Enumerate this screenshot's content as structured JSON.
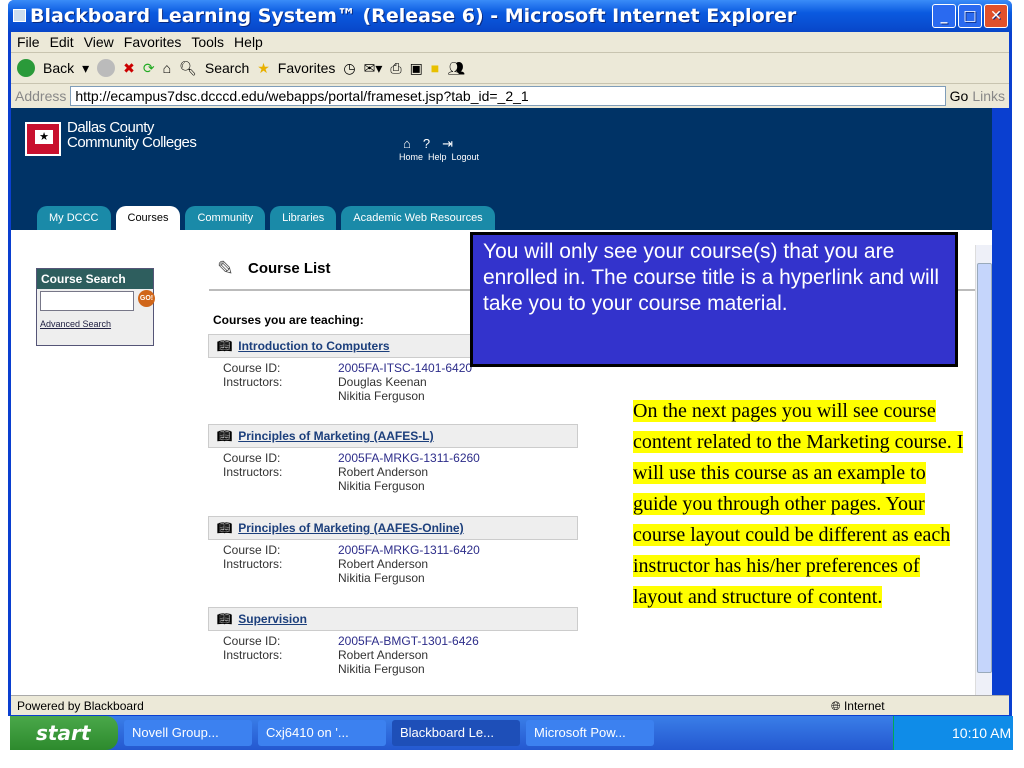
{
  "window": {
    "title": "Blackboard Learning System™ (Release 6) - Microsoft Internet Explorer"
  },
  "menu": [
    "File",
    "Edit",
    "View",
    "Favorites",
    "Tools",
    "Help"
  ],
  "toolbar": {
    "back": "Back",
    "search": "Search",
    "favorites": "Favorites"
  },
  "address": {
    "label": "Address",
    "url": "http://ecampus7dsc.dcccd.edu/webapps/portal/frameset.jsp?tab_id=_2_1",
    "go": "Go",
    "links": "Links"
  },
  "header": {
    "brand_line1": "Dallas County",
    "brand_line2": "Community Colleges",
    "home": "Home",
    "help": "Help",
    "logout": "Logout"
  },
  "tabs": [
    "My DCCC",
    "Courses",
    "Community",
    "Libraries",
    "Academic Web Resources"
  ],
  "sidebar": {
    "title": "Course Search",
    "go": "GO!",
    "advanced": "Advanced Search"
  },
  "main": {
    "title": "Course List",
    "section": "Courses you are teaching:",
    "id_label": "Course ID:",
    "instructors_label": "Instructors:",
    "courses": [
      {
        "name": "Introduction to Computers",
        "id": "2005FA-ITSC-1401-6420",
        "instructors": [
          "Douglas Keenan",
          "Nikitia Ferguson"
        ]
      },
      {
        "name": "Principles of Marketing (AAFES-L)",
        "id": "2005FA-MRKG-1311-6260",
        "instructors": [
          "Robert Anderson",
          "Nikitia Ferguson"
        ]
      },
      {
        "name": "Principles of Marketing (AAFES-Online)",
        "id": "2005FA-MRKG-1311-6420",
        "instructors": [
          "Robert Anderson",
          "Nikitia Ferguson"
        ]
      },
      {
        "name": "Supervision",
        "id": "2005FA-BMGT-1301-6426",
        "instructors": [
          "Robert Anderson",
          "Nikitia Ferguson"
        ]
      }
    ]
  },
  "callouts": {
    "blue": "You will only see your course(s) that you are enrolled in. The course title is a hyperlink and will take you to your course material.",
    "yellow": "On the next pages you will see course content related to the Marketing course. I will use this course as an example to guide you through other pages. Your course layout could be different as each instructor has his/her preferences of layout and structure of content."
  },
  "status": {
    "left": "Powered by Blackboard",
    "zone": "Internet"
  },
  "taskbar": {
    "start": "start",
    "tasks": [
      "Novell Group...",
      "Cxj6410 on '...",
      "Blackboard Le...",
      "Microsoft Pow..."
    ],
    "clock": "10:10 AM"
  },
  "colors": {
    "header": "#003366",
    "tab": "#1a8aa8",
    "blue_callout": "#3333cc",
    "yellow_highlight": "#ffff00"
  }
}
